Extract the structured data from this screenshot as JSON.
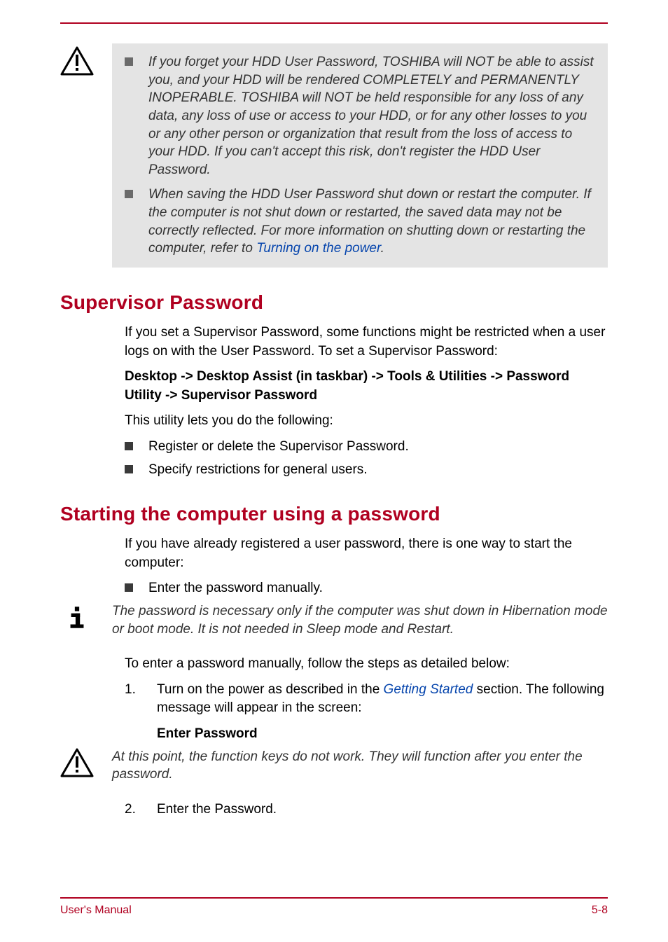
{
  "callout1": {
    "bullets": [
      {
        "text_before_link": "If you forget your HDD User Password, TOSHIBA will NOT be able to assist you, and your HDD will be rendered COMPLETELY and PERMANENTLY INOPERABLE. TOSHIBA will NOT be held responsible for any loss of any data, any loss of use or access to your HDD, or for any other losses to you or any other person or organization that result from the loss of access to your HDD. If you can't accept this risk, don't register the HDD User Password.",
        "link_text": "",
        "text_after_link": ""
      },
      {
        "text_before_link": "When saving the HDD User Password shut down or restart the computer. If the computer is not shut down or restarted, the saved data may not be correctly reflected. For more information on shutting down or restarting the computer, refer to ",
        "link_text": "Turning on the power",
        "text_after_link": "."
      }
    ]
  },
  "section1": {
    "heading": "Supervisor Password",
    "p1": "If you set a Supervisor Password, some functions might be restricted when a user logs on with the User Password. To set a Supervisor Password:",
    "p2": "Desktop -> Desktop Assist (in taskbar) -> Tools & Utilities -> Password Utility -> Supervisor Password",
    "p3": "This utility lets you do the following:",
    "items": [
      "Register or delete the Supervisor Password.",
      "Specify restrictions for general users."
    ]
  },
  "section2": {
    "heading": "Starting the computer using a password",
    "p1": "If you have already registered a user password, there is one way to start the computer:",
    "items": [
      "Enter the password manually."
    ],
    "note1": "The password is necessary only if the computer was shut down in Hibernation mode or boot mode. It is not needed in Sleep mode and Restart.",
    "p2": "To enter a password manually, follow the steps as detailed below:",
    "step1_before": "Turn on the power as described in the ",
    "step1_link": "Getting Started",
    "step1_after": " section. The following message will appear in the screen:",
    "step1_num": "1.",
    "enter_password": "Enter Password",
    "note2": "At this point, the function keys do not work. They will function after you enter the password.",
    "step2_num": "2.",
    "step2": "Enter the Password."
  },
  "footer": {
    "left": "User's Manual",
    "right": "5-8"
  }
}
